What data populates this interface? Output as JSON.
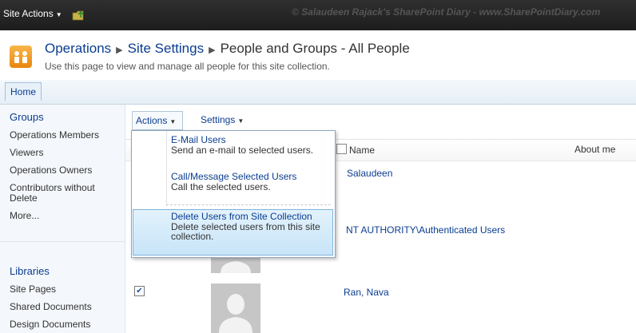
{
  "topbar": {
    "site_actions": "Site Actions",
    "watermark": "© Salaudeen Rajack's SharePoint Diary - www.SharePointDiary.com"
  },
  "header": {
    "breadcrumb": [
      "Operations",
      "Site Settings",
      "People and Groups - All People"
    ],
    "description": "Use this page to view and manage all people for this site collection."
  },
  "tabs": {
    "home": "Home"
  },
  "leftnav": {
    "groups_heading": "Groups",
    "groups": [
      "Operations Members",
      "Viewers",
      "Operations Owners",
      "Contributors without Delete",
      "More..."
    ],
    "libraries_heading": "Libraries",
    "libraries": [
      "Site Pages",
      "Shared Documents",
      "Design Documents"
    ]
  },
  "toolbar": {
    "actions": "Actions",
    "settings": "Settings"
  },
  "list": {
    "col_name": "Name",
    "col_about": "About me",
    "rows": [
      {
        "name": "Salaudeen",
        "checked": false
      },
      {
        "name": "NT AUTHORITY\\Authenticated Users",
        "checked": false
      },
      {
        "name": "Ran, Nava",
        "checked": true
      }
    ]
  },
  "menu": {
    "items": [
      {
        "title": "E-Mail Users",
        "desc": "Send an e-mail to selected users."
      },
      {
        "title": "Call/Message Selected Users",
        "desc": "Call the selected users."
      },
      {
        "title": "Delete Users from Site Collection",
        "desc": "Delete selected users from this site collection."
      }
    ]
  }
}
